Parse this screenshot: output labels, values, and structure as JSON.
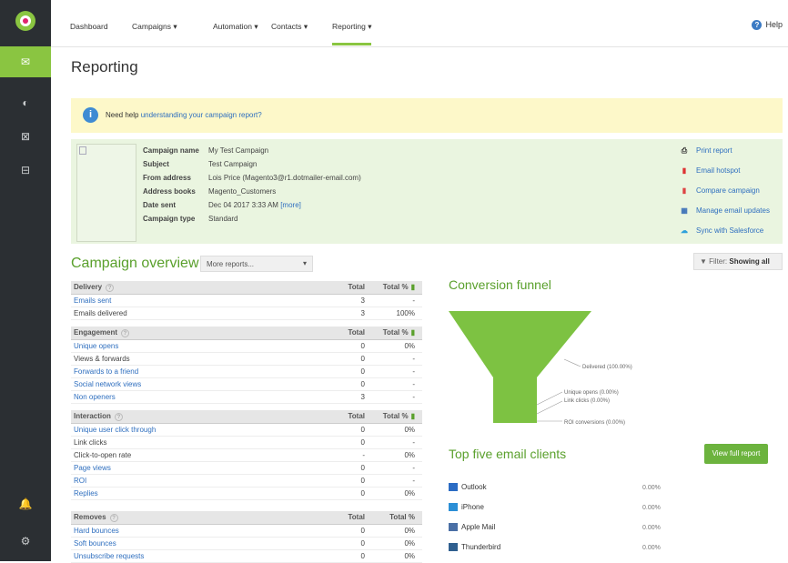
{
  "sidebar": {
    "items": [
      "email-icon",
      "pie-chart-icon",
      "layout-icon",
      "report-icon",
      "bell-icon",
      "user-settings-icon"
    ]
  },
  "nav": {
    "items": [
      "Dashboard",
      "Campaigns ▾",
      "Automation ▾",
      "Contacts ▾",
      "Reporting ▾"
    ],
    "help": "Help"
  },
  "page_title": "Reporting",
  "banner": {
    "prefix": "Need help ",
    "link": "understanding your campaign report?"
  },
  "campaign": {
    "fields": [
      {
        "k": "Campaign name",
        "v": "My Test Campaign"
      },
      {
        "k": "Subject",
        "v": "Test Campaign"
      },
      {
        "k": "From address",
        "v": "Lois Price (Magento3@r1.dotmailer-email.com)"
      },
      {
        "k": "Address books",
        "v": "Magento_Customers"
      },
      {
        "k": "Date sent",
        "v": "Dec 04 2017 3:33 AM",
        "link": "[more]"
      },
      {
        "k": "Campaign type",
        "v": "Standard"
      }
    ],
    "actions": [
      "Print report",
      "Email hotspot",
      "Compare campaign",
      "Manage email updates",
      "Sync with Salesforce"
    ]
  },
  "overview": {
    "title": "Campaign overview",
    "more_reports": "More reports...",
    "filter_label": "Filter:",
    "filter_value": "Showing all"
  },
  "sections": [
    {
      "name": "Delivery",
      "cols": [
        "Total",
        "Total %"
      ],
      "rows": [
        {
          "label": "Emails sent",
          "link": true,
          "total": "3",
          "pct": "-"
        },
        {
          "label": "Emails delivered",
          "link": false,
          "total": "3",
          "pct": "100%"
        }
      ]
    },
    {
      "name": "Engagement",
      "cols": [
        "Total",
        "Total %"
      ],
      "rows": [
        {
          "label": "Unique opens",
          "link": true,
          "total": "0",
          "pct": "0%"
        },
        {
          "label": "Views & forwards",
          "link": false,
          "total": "0",
          "pct": "-"
        },
        {
          "label": "Forwards to a friend",
          "link": true,
          "total": "0",
          "pct": "-"
        },
        {
          "label": "Social network views",
          "link": true,
          "total": "0",
          "pct": "-"
        },
        {
          "label": "Non openers",
          "link": true,
          "total": "3",
          "pct": "-"
        }
      ]
    },
    {
      "name": "Interaction",
      "cols": [
        "Total",
        "Total %"
      ],
      "rows": [
        {
          "label": "Unique user click through",
          "link": true,
          "total": "0",
          "pct": "0%"
        },
        {
          "label": "Link clicks",
          "link": false,
          "total": "0",
          "pct": "-"
        },
        {
          "label": "Click-to-open rate",
          "link": false,
          "total": "-",
          "pct": "0%"
        },
        {
          "label": "Page views",
          "link": true,
          "total": "0",
          "pct": "-"
        },
        {
          "label": "ROI",
          "link": true,
          "total": "0",
          "pct": "-"
        },
        {
          "label": "Replies",
          "link": true,
          "total": "0",
          "pct": "0%"
        }
      ]
    },
    {
      "name": "Removes",
      "cols": [
        "Total",
        "Total %"
      ],
      "rows": [
        {
          "label": "Hard bounces",
          "link": true,
          "total": "0",
          "pct": "0%"
        },
        {
          "label": "Soft bounces",
          "link": true,
          "total": "0",
          "pct": "0%"
        },
        {
          "label": "Unsubscribe requests",
          "link": true,
          "total": "0",
          "pct": "0%"
        }
      ]
    }
  ],
  "funnel": {
    "title": "Conversion funnel",
    "labels": [
      "Delivered (100.00%)",
      "Unique opens (0.00%)",
      "Link clicks (0.00%)",
      "ROI conversions (0.00%)"
    ],
    "color": "#7dc242"
  },
  "clients": {
    "title": "Top five email clients",
    "button": "View full report",
    "items": [
      {
        "name": "Outlook",
        "pct": "0.00%",
        "color": "#2b6cc4"
      },
      {
        "name": "iPhone",
        "pct": "0.00%",
        "color": "#2b8fd6"
      },
      {
        "name": "Apple Mail",
        "pct": "0.00%",
        "color": "#4a6fa5"
      },
      {
        "name": "Thunderbird",
        "pct": "0.00%",
        "color": "#2f5f8f"
      }
    ]
  }
}
